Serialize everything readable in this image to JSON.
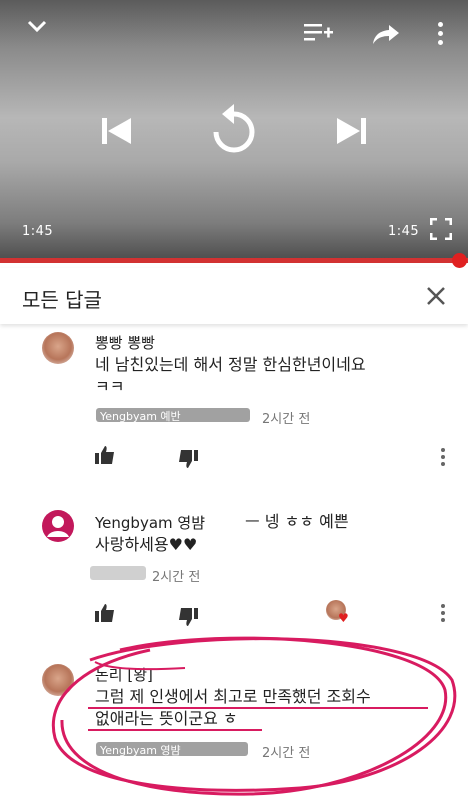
{
  "player": {
    "time_elapsed": "1:45",
    "time_total": "1:45",
    "progress_fraction": 1.0
  },
  "header": {
    "title": "모든 답글"
  },
  "comments": [
    {
      "author": "뽕빵 뽕빵",
      "text_line1": "네 남친있는데 해서 정말 한심한년이네요",
      "text_line2": "ㅋㅋ",
      "handle": "Yengbyam 예반",
      "time": "2시간 전"
    },
    {
      "author": "Yengbyam 영뱜",
      "reply_text": "ㅡ 넹 ㅎㅎ 예쁜",
      "text_line2": "사랑하세용♥♥",
      "time": "2시간 전"
    },
    {
      "author": "논리 [왕]",
      "text_line1": "그럼 제 인생에서 최고로 만족했던 조회수",
      "text_line2": "없애라는 뜻이군요 ㅎ",
      "handle": "Yengbyam 영뱜",
      "time": "2시간 전"
    }
  ],
  "colors": {
    "accent_red": "#e02020",
    "highlight_pink": "#d81b60"
  }
}
